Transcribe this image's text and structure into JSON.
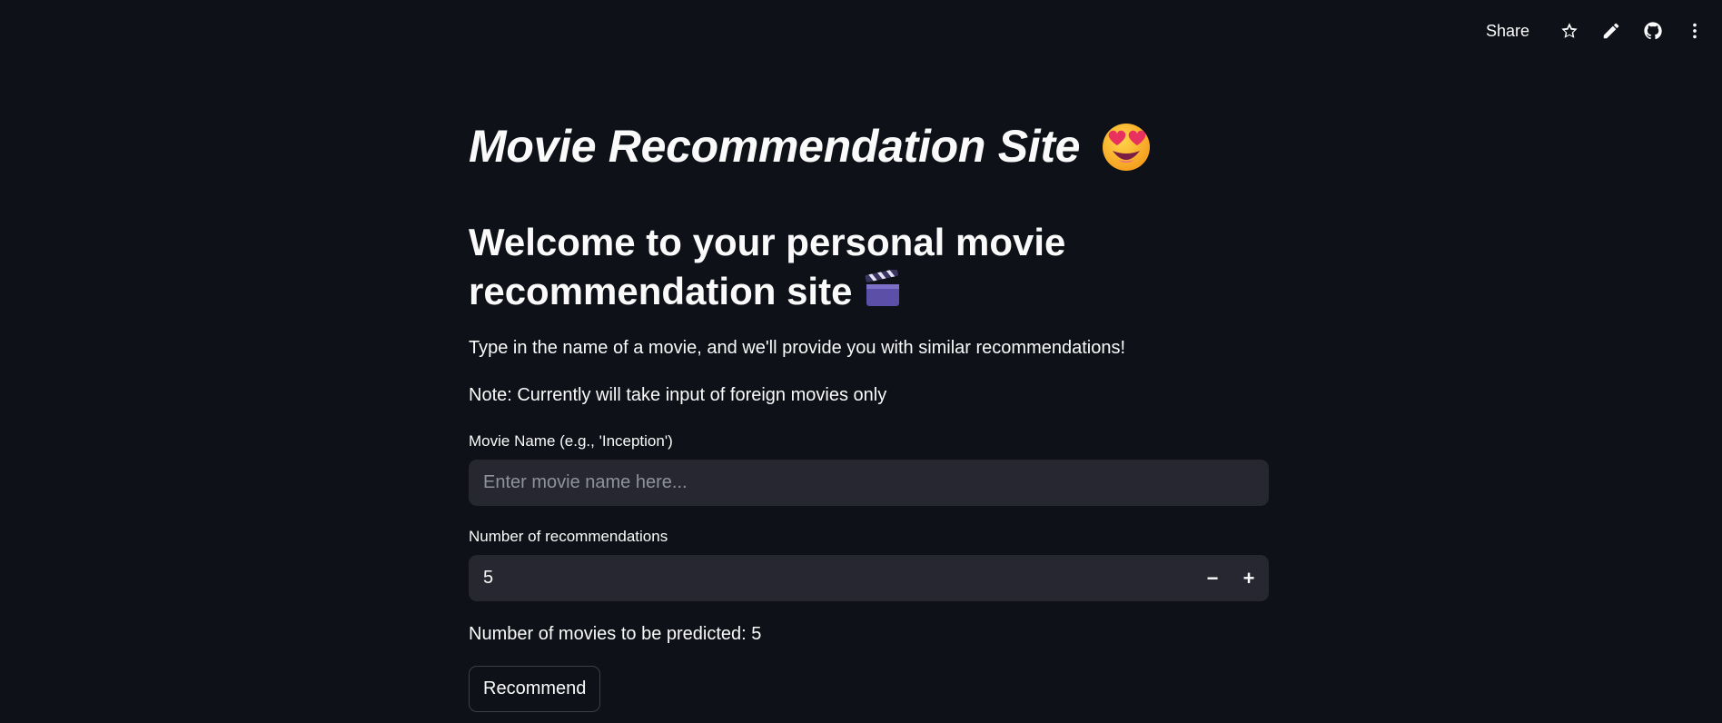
{
  "toolbar": {
    "share_label": "Share",
    "icons": [
      "star-icon",
      "pencil-icon",
      "github-icon",
      "more-vertical-icon"
    ]
  },
  "main": {
    "title": "Movie Recommendation Site",
    "title_emoji": "smiling-face-with-heart-eyes",
    "subtitle_line1": "Welcome to your personal movie",
    "subtitle_line2": "recommendation site",
    "subtitle_emoji": "clapper-board",
    "description": "Type in the name of a movie, and we'll provide you with similar recommendations!",
    "note": "Note: Currently will take input of foreign movies only",
    "movie_label": "Movie Name (e.g., 'Inception')",
    "movie_placeholder": "Enter movie name here...",
    "movie_value": "",
    "num_label": "Number of recommendations",
    "num_value": "5",
    "minus_label": "−",
    "plus_label": "+",
    "predict_text": "Number of movies to be predicted: 5",
    "recommend_label": "Recommend"
  }
}
